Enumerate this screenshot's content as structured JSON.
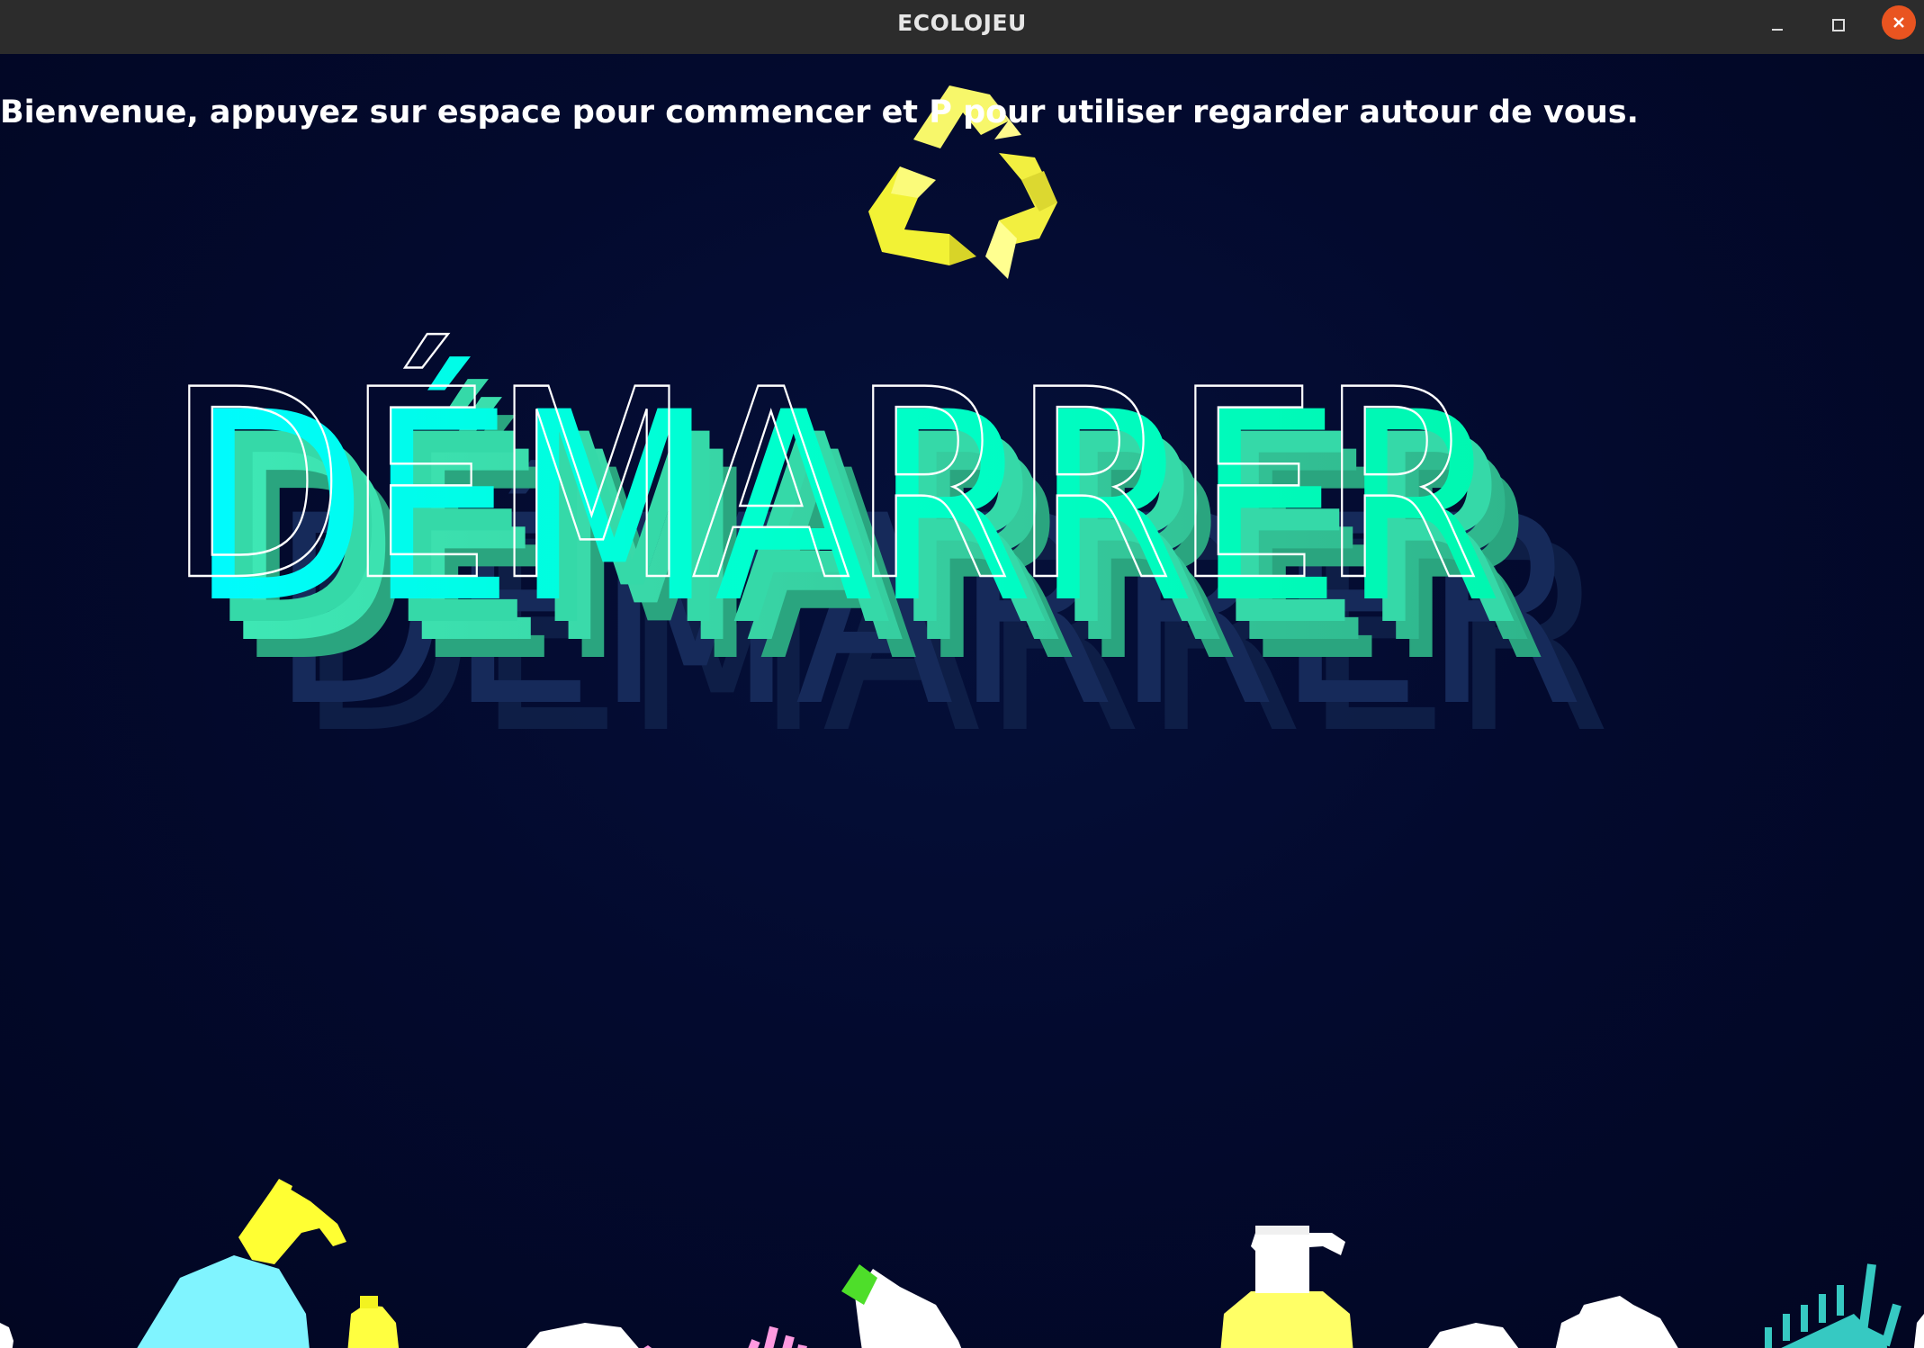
{
  "window": {
    "title": "ECOLOJEU",
    "controls": {
      "minimize_icon": "minimize-icon",
      "maximize_icon": "maximize-icon",
      "close_icon": "close-icon"
    }
  },
  "game": {
    "instruction": "Bienvenue, appuyez sur espace pour commencer et P pour utiliser regarder autour de vous.",
    "logo_icon": "recycle-icon",
    "start_label": "DÉMARRER",
    "waste_items": [
      "bottle-icon",
      "pump-bottle-icon",
      "brush-icon",
      "comb-icon",
      "bag-icon"
    ]
  },
  "colors": {
    "titlebar": "#2c2c2c",
    "background": "#030a2e",
    "start_front": "#00ffd5",
    "start_side": "#2cc79a",
    "start_shadow": "#17264d",
    "logo": "#f5f542",
    "close": "#e95420"
  }
}
